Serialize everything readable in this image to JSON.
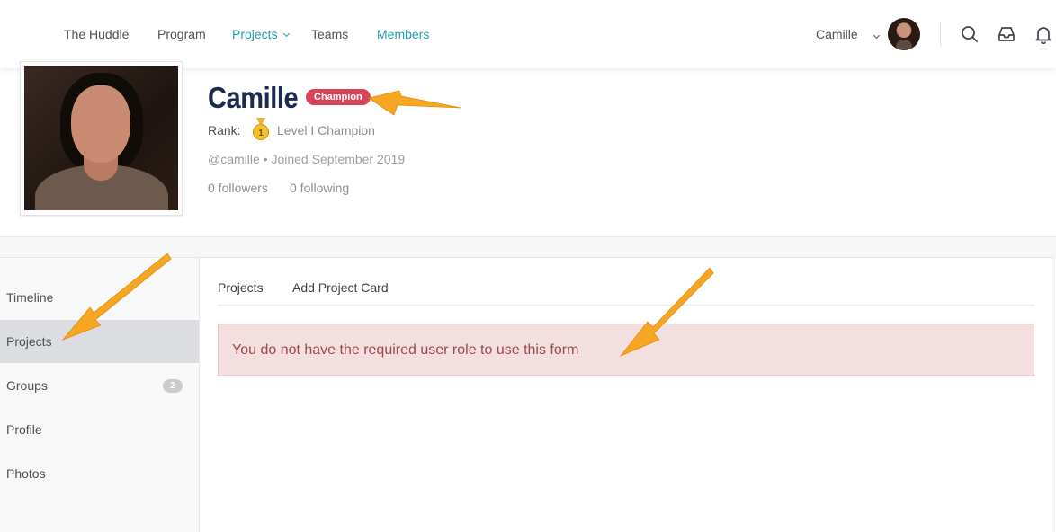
{
  "header": {
    "nav": [
      {
        "label": "The Huddle",
        "active": false
      },
      {
        "label": "Program",
        "active": false
      },
      {
        "label": "Projects",
        "active": true,
        "dropdown": true
      },
      {
        "label": "Teams",
        "active": false
      },
      {
        "label": "Members",
        "active": true
      }
    ],
    "user_name": "Camille",
    "icons": [
      "search-icon",
      "inbox-icon",
      "bell-icon"
    ]
  },
  "profile": {
    "name": "Camille",
    "badge": "Champion",
    "rank_label": "Rank:",
    "rank_value": "Level I Champion",
    "medal_number": "1",
    "handle_line": "@camille • Joined September 2019",
    "followers": "0 followers",
    "following": "0 following"
  },
  "sidebar": {
    "items": [
      {
        "label": "Timeline",
        "active": false,
        "count": ""
      },
      {
        "label": "Projects",
        "active": true,
        "count": ""
      },
      {
        "label": "Groups",
        "active": false,
        "count": "2"
      },
      {
        "label": "Profile",
        "active": false,
        "count": ""
      },
      {
        "label": "Photos",
        "active": false,
        "count": ""
      }
    ]
  },
  "content": {
    "tabs": [
      {
        "label": "Projects"
      },
      {
        "label": "Add Project Card"
      }
    ],
    "alert": "You do not have the required user role to use this form"
  },
  "colors": {
    "accent": "#1f9cb1",
    "badge": "#d9435a",
    "alert_bg": "#f4dfe0",
    "alert_text": "#9b4a4a",
    "arrow": "#f5a623"
  }
}
